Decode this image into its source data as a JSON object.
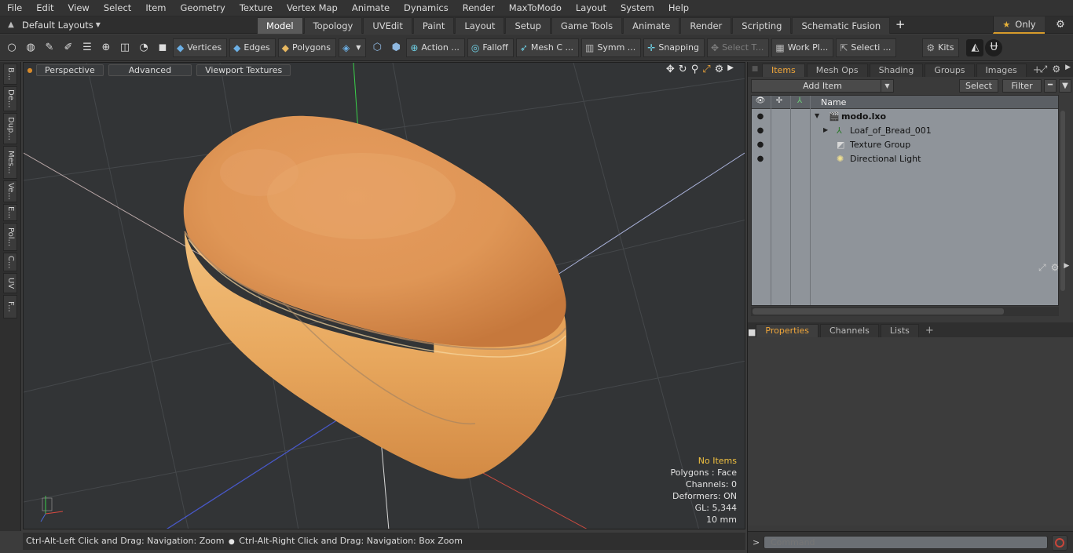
{
  "menu": [
    "File",
    "Edit",
    "View",
    "Select",
    "Item",
    "Geometry",
    "Texture",
    "Vertex Map",
    "Animate",
    "Dynamics",
    "Render",
    "MaxToModo",
    "Layout",
    "System",
    "Help"
  ],
  "layout": {
    "label": "Default Layouts",
    "tabs": [
      "Model",
      "Topology",
      "UVEdit",
      "Paint",
      "Layout",
      "Setup",
      "Game Tools",
      "Animate",
      "Render",
      "Scripting",
      "Schematic Fusion"
    ],
    "active_tab": "Model",
    "only_label": "Only"
  },
  "toolbar": {
    "vertices": "Vertices",
    "edges": "Edges",
    "polygons": "Polygons",
    "action": "Action ...",
    "falloff": "Falloff",
    "mesh": "Mesh C ...",
    "symm": "Symm ...",
    "snapping": "Snapping",
    "select_t": "Select T...",
    "work_pl": "Work Pl...",
    "selecti": "Selecti ...",
    "kits": "Kits"
  },
  "left_tabs": [
    "B...",
    "De...",
    "Dup...",
    "Mes...",
    "Ve...",
    "E...",
    "Pol...",
    "C...",
    "UV",
    "F..."
  ],
  "viewport": {
    "mode": "Perspective",
    "advanced": "Advanced",
    "textures": "Viewport Textures",
    "info": {
      "items": "No Items",
      "polygons": "Polygons : Face",
      "channels": "Channels: 0",
      "deformers": "Deformers: ON",
      "gl": "GL: 5,344",
      "scale": "10 mm"
    }
  },
  "status": {
    "left": "Ctrl-Alt-Left Click and Drag: Navigation: Zoom",
    "right": "Ctrl-Alt-Right Click and Drag: Navigation: Box Zoom"
  },
  "items_panel": {
    "tabs": [
      "Items",
      "Mesh Ops",
      "Shading",
      "Groups",
      "Images"
    ],
    "add_item": "Add Item",
    "select": "Select",
    "filter": "Filter",
    "name_col": "Name",
    "rows": [
      {
        "label": "modo.lxo",
        "icon": "scene-icon"
      },
      {
        "label": "Loaf_of_Bread_001",
        "icon": "mesh-icon"
      },
      {
        "label": "Texture Group",
        "icon": "texture-group-icon"
      },
      {
        "label": "Directional Light",
        "icon": "light-icon"
      }
    ]
  },
  "props_panel": {
    "tabs": [
      "Properties",
      "Channels",
      "Lists"
    ]
  },
  "command": {
    "placeholder": "Command"
  },
  "colors": {
    "accent": "#f0a63a",
    "viewport_bg": "#323436",
    "tree_bg": "#8f949a",
    "bread": "#e7a45a"
  }
}
